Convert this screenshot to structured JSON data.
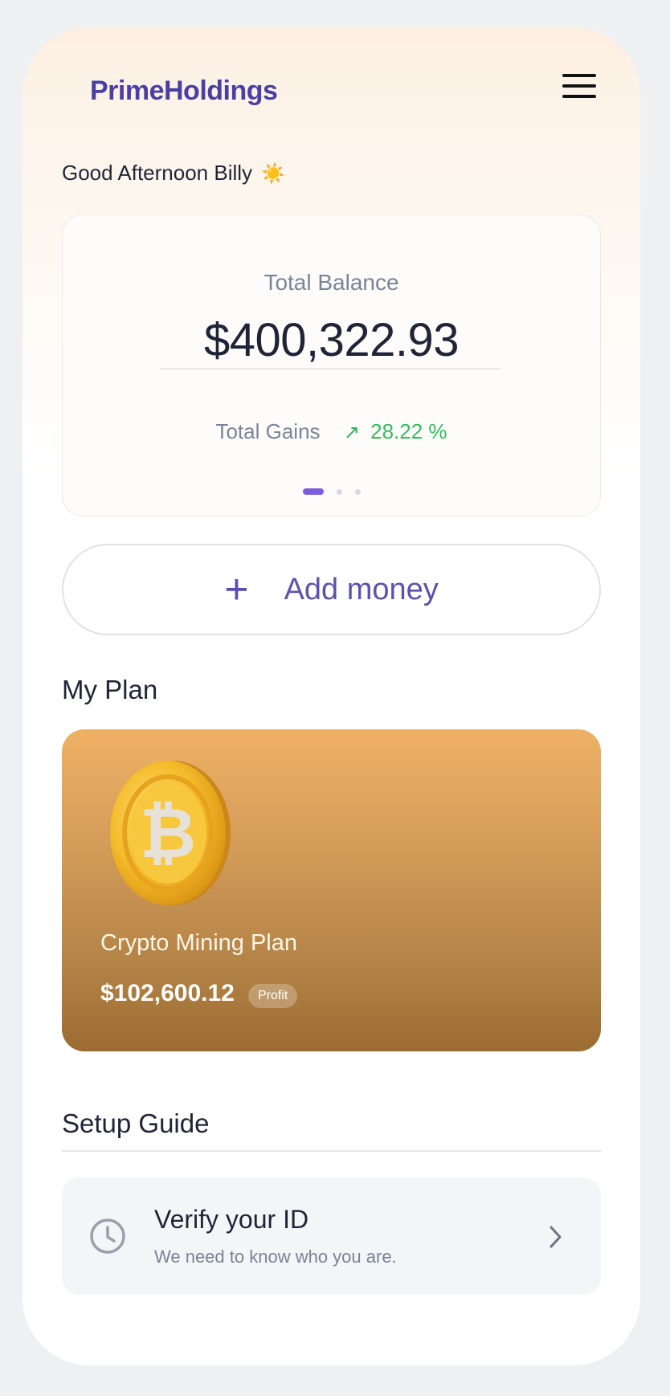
{
  "header": {
    "brand": "PrimeHoldings",
    "menu_icon": "hamburger-menu-icon"
  },
  "greeting": {
    "text": "Good Afternoon Billy",
    "icon": "sun-emoji",
    "icon_glyph": "☀️"
  },
  "balance": {
    "label": "Total Balance",
    "amount": "$400,322.93",
    "gains_label": "Total Gains",
    "gains_arrow": "↗",
    "gains_value": "28.22 %",
    "carousel_pages": 3,
    "carousel_active": 1
  },
  "actions": {
    "add_money_icon": "+",
    "add_money_label": "Add money"
  },
  "plan": {
    "section_title": "My Plan",
    "name": "Crypto Mining Plan",
    "amount": "$102,600.12",
    "badge": "Profit",
    "image": "bitcoin-coin"
  },
  "guide": {
    "section_title": "Setup Guide",
    "items": [
      {
        "title": "Verify your ID",
        "subtitle": "We need to know who you are.",
        "icon": "clock-icon"
      }
    ]
  },
  "colors": {
    "brand": "#4a3fa3",
    "accent": "#7b5ce0",
    "gain": "#2fbf5c",
    "plan_gradient_top": "#eeb164",
    "plan_gradient_bottom": "#9b6c32"
  }
}
